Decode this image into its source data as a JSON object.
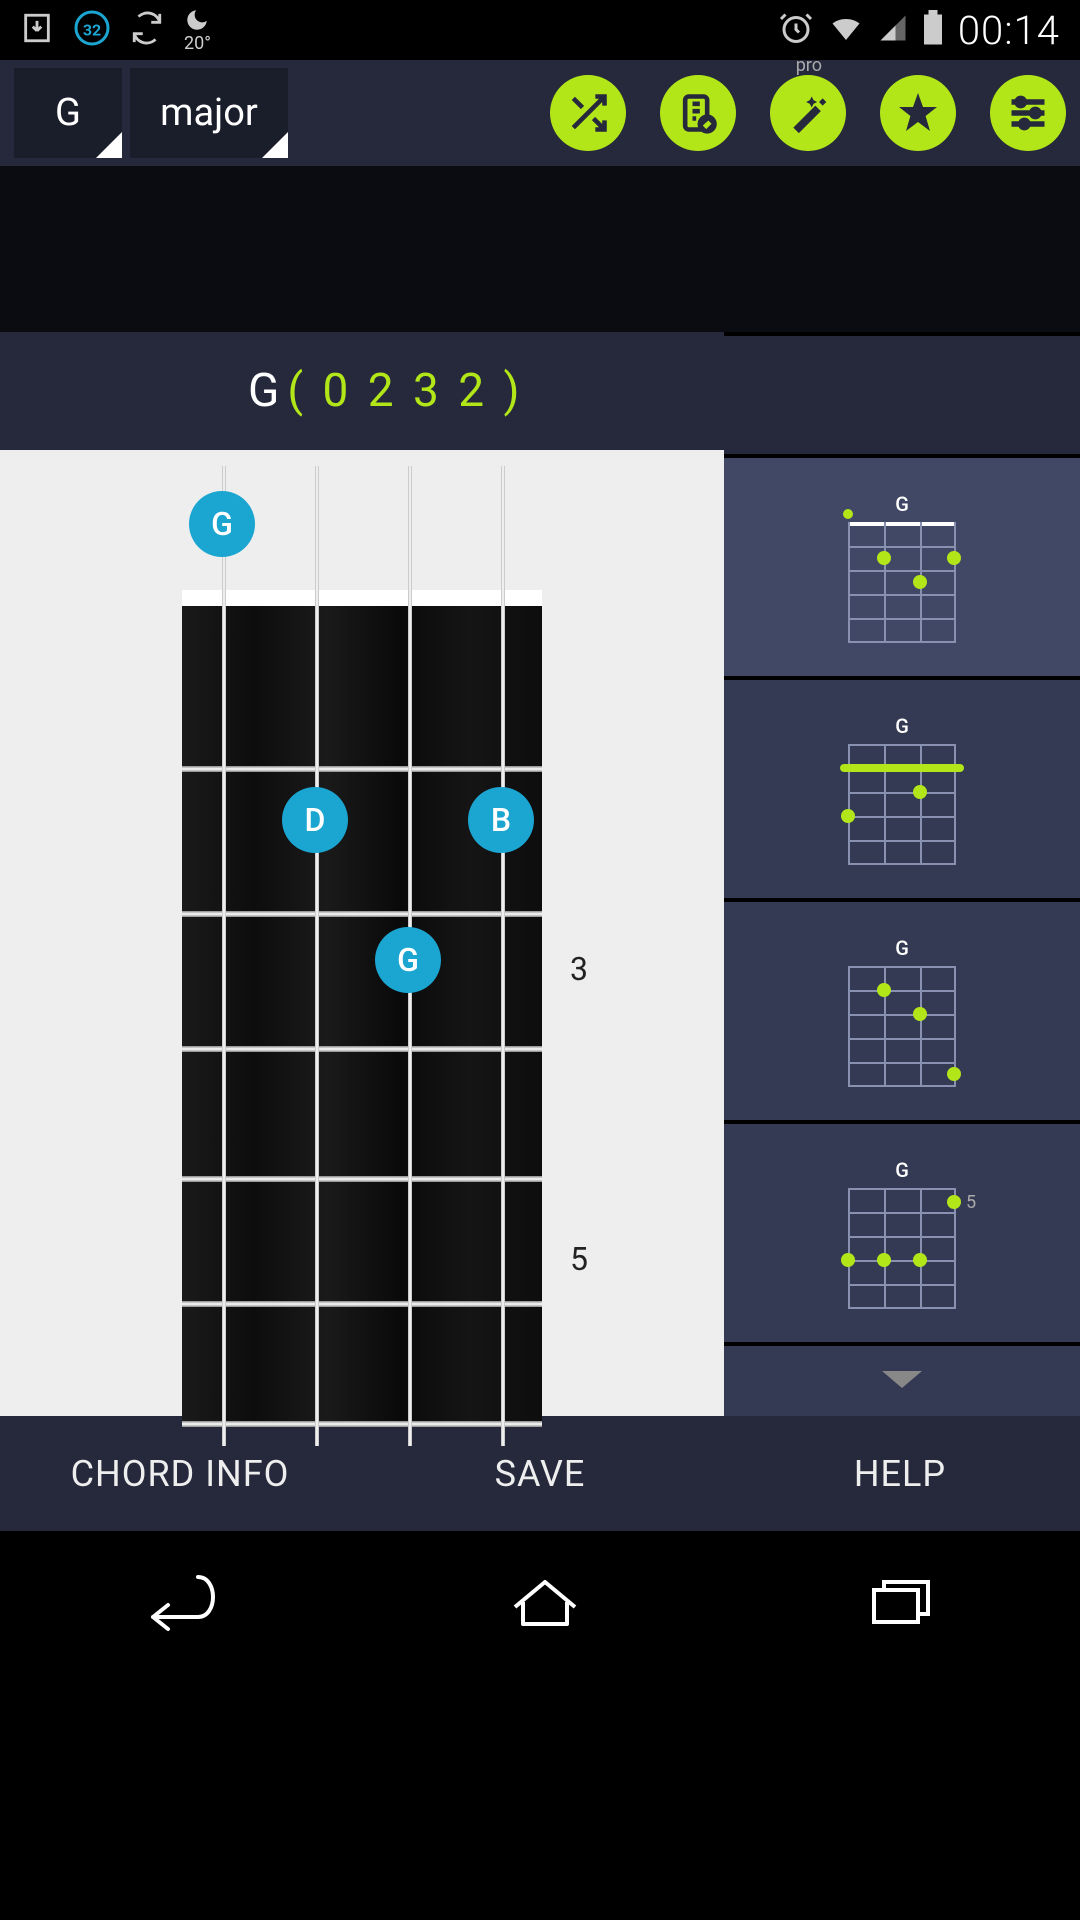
{
  "statusbar": {
    "temp": "20°",
    "time": "00:14",
    "badge": "32"
  },
  "toolbar": {
    "note": "G",
    "quality": "major",
    "pro_label": "pro"
  },
  "chord": {
    "root": "G",
    "positions_label": "( 0 2 3 2 )",
    "fret_markers": {
      "third": "3",
      "fifth": "5"
    },
    "finger_labels": {
      "open": "G",
      "s2f2": "D",
      "s4f2": "B",
      "s3f3": "G"
    }
  },
  "variations": [
    {
      "label": "G",
      "type": "open"
    },
    {
      "label": "G",
      "type": "barre"
    },
    {
      "label": "G",
      "type": "pos3"
    },
    {
      "label": "G",
      "type": "pos5",
      "sidemark": "5"
    }
  ],
  "bottom": {
    "info": "CHORD INFO",
    "save": "SAVE",
    "help": "HELP"
  }
}
